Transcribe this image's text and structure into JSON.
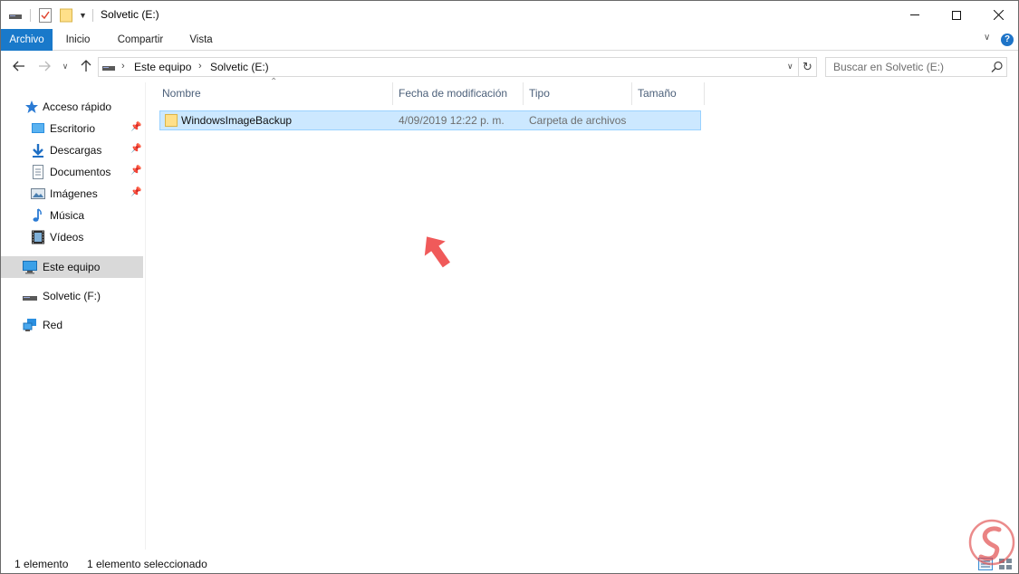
{
  "window": {
    "title": "Solvetic (E:)"
  },
  "ribbon": {
    "tabs": [
      "Archivo",
      "Inicio",
      "Compartir",
      "Vista"
    ],
    "help": "?"
  },
  "address_bar": {
    "breadcrumbs": [
      "Este equipo",
      "Solvetic (E:)"
    ]
  },
  "search": {
    "placeholder": "Buscar en Solvetic (E:)"
  },
  "sidebar": {
    "quick_access": "Acceso rápido",
    "items": [
      {
        "label": "Escritorio",
        "icon": "desktop-icon",
        "pinned": true
      },
      {
        "label": "Descargas",
        "icon": "download-icon",
        "pinned": true
      },
      {
        "label": "Documentos",
        "icon": "documents-icon",
        "pinned": true
      },
      {
        "label": "Imágenes",
        "icon": "pictures-icon",
        "pinned": true
      },
      {
        "label": "Música",
        "icon": "music-icon",
        "pinned": false
      },
      {
        "label": "Vídeos",
        "icon": "videos-icon",
        "pinned": false
      }
    ],
    "this_pc": "Este equipo",
    "drive_f": "Solvetic (F:)",
    "network": "Red"
  },
  "file_list": {
    "columns": [
      "Nombre",
      "Fecha de modificación",
      "Tipo",
      "Tamaño"
    ],
    "rows": [
      {
        "name": "WindowsImageBackup",
        "modified": "4/09/2019 12:22 p. m.",
        "type": "Carpeta de archivos",
        "size": "",
        "selected": true
      }
    ]
  },
  "status_bar": {
    "item_count": "1 elemento",
    "selection": "1 elemento seleccionado"
  },
  "colors": {
    "accent": "#1979ca",
    "selection_bg": "#cce8ff",
    "selection_border": "#99d1ff",
    "annotation_arrow": "#f05a5a"
  }
}
